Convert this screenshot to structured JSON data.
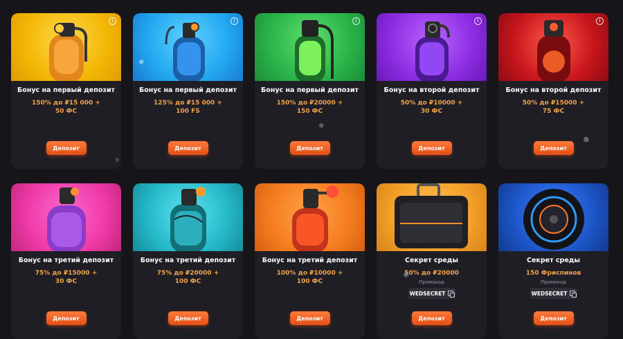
{
  "cards": [
    {
      "title": "Бонус на первый депозит",
      "offer": "150% до ₽15 000 +\n50 ФС",
      "button": "Депозит",
      "bg": "#f2b705",
      "accent": "#f28c0f",
      "object": "tank"
    },
    {
      "title": "Бонус на первый депозит",
      "offer": "125% до ₽15 000 +\n100 FS",
      "button": "Депозит",
      "bg": "#22a7f0",
      "accent": "#1b72c9",
      "object": "tank"
    },
    {
      "title": "Бонус на первый депозит",
      "offer": "150% до ₽20000 +\n150 ФС",
      "button": "Депозит",
      "bg": "#29b34a",
      "accent": "#6fe25d",
      "object": "tank"
    },
    {
      "title": "Бонус на второй депозит",
      "offer": "50% до ₽10000 +\n30 ФС",
      "button": "Депозит",
      "bg": "#8e2de2",
      "accent": "#b865ff",
      "object": "tank"
    },
    {
      "title": "Бонус на второй депозит",
      "offer": "50% до ₽15000 +\n75 ФС",
      "button": "Депозит",
      "bg": "#c8161d",
      "accent": "#ff4b3e",
      "object": "tank"
    },
    {
      "title": "Бонус на третий депозит",
      "offer": "75% до ₽15000 +\n30 ФС",
      "button": "Депозит",
      "bg": "#ee3aa7",
      "accent": "#8a3cc8",
      "object": "tank"
    },
    {
      "title": "Бонус на третий депозит",
      "offer": "75% до ₽20000 +\n100 ФС",
      "button": "Депозит",
      "bg": "#25b9c9",
      "accent": "#1a8a95",
      "object": "tank"
    },
    {
      "title": "Бонус на третий депозит",
      "offer": "100% до ₽10000 +\n100 ФС",
      "button": "Депозит",
      "bg": "#f57d1f",
      "accent": "#e3401a",
      "object": "tank"
    },
    {
      "title": "Секрет среды",
      "offer": "50% до ₽20000",
      "promo_label": "Промокод",
      "promo_code": "WEDSECRET",
      "button": "Депозит",
      "bg": "#f2a12a",
      "accent": "#2a2a30",
      "object": "case"
    },
    {
      "title": "Секрет среды",
      "offer": "150 Фриспинов",
      "promo_label": "Промокод",
      "promo_code": "WEDSECRET",
      "button": "Депозит",
      "bg": "#1d56c9",
      "accent": "#0f0f18",
      "object": "wheel"
    }
  ],
  "icons": {
    "info": "info-icon",
    "copy": "copy-icon",
    "snowflake": "snowflake-icon"
  }
}
